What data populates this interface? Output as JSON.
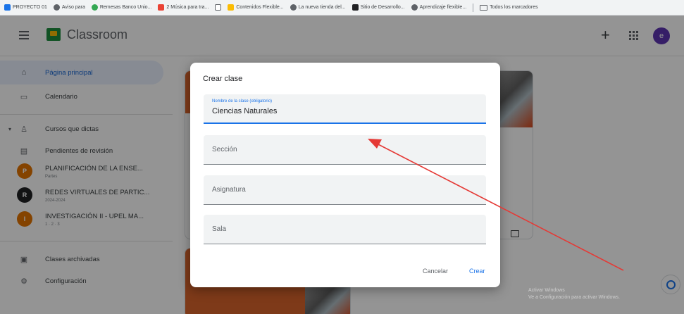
{
  "bookmarks": [
    {
      "label": "PROYECTO 01",
      "color": "#1a73e8"
    },
    {
      "label": "Aviso para",
      "color": "#5f6368"
    },
    {
      "label": "Remesas Banco Unio...",
      "color": "#34a853"
    },
    {
      "label": "2 Música para tra...",
      "color": "#ea4335"
    },
    {
      "label": "",
      "color": "#5f6368"
    },
    {
      "label": "Contenidos Flexible...",
      "color": "#fbbc04"
    },
    {
      "label": "La nueva tienda del...",
      "color": "#5f6368"
    },
    {
      "label": "Sitio de Desarrollo...",
      "color": "#202124"
    },
    {
      "label": "Aprendizaje flexible...",
      "color": "#5f6368"
    }
  ],
  "bookmarks_all": "Todos los marcadores",
  "header": {
    "app_title": "Classroom",
    "avatar_letter": "e"
  },
  "sidebar": {
    "items": [
      {
        "label": "Página principal",
        "icon": "home-icon"
      },
      {
        "label": "Calendario",
        "icon": "calendar-icon"
      },
      {
        "label": "Cursos que dictas",
        "icon": "people-icon"
      },
      {
        "label": "Pendientes de revisión",
        "icon": "folder-check-icon"
      }
    ],
    "courses": [
      {
        "title": "PLANIFICACIÓN DE LA ENSE...",
        "sub": "Partes",
        "initial": "P",
        "color": "#e37400"
      },
      {
        "title": "REDES VIRTUALES DE PARTIC...",
        "sub": "2024-2024",
        "initial": "R",
        "color": "#202124"
      },
      {
        "title": "INVESTIGACIÓN II - UPEL MA...",
        "sub": "1 · 2 · 3",
        "initial": "I",
        "color": "#e37400"
      }
    ],
    "bottom": [
      {
        "label": "Clases archivadas",
        "icon": "archive-icon"
      },
      {
        "label": "Configuración",
        "icon": "gear-icon"
      }
    ]
  },
  "dialog": {
    "title": "Crear clase",
    "fields": [
      {
        "label": "Nombre de la clase (obligatorio)",
        "value": "Ciencias Naturales"
      },
      {
        "placeholder": "Sección"
      },
      {
        "placeholder": "Asignatura"
      },
      {
        "placeholder": "Sala"
      }
    ],
    "cancel_label": "Cancelar",
    "create_label": "Crear"
  },
  "watermark": {
    "line1": "Activar Windows",
    "line2": "Ve a Configuración para activar Windows."
  },
  "colors": {
    "accent": "#1a73e8",
    "arrow": "#e53935",
    "active_nav": "#e8f0fe"
  }
}
